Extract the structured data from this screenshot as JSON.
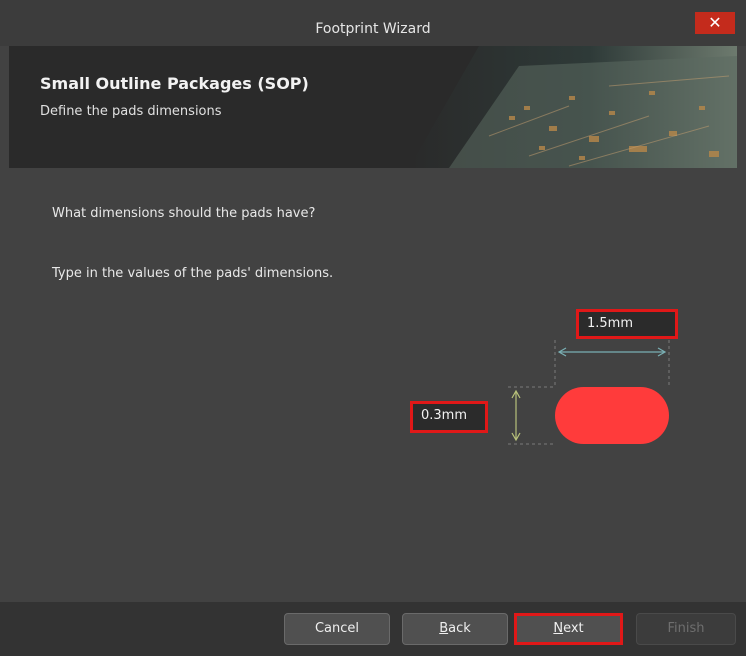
{
  "window": {
    "title": "Footprint Wizard",
    "close_glyph": "✕"
  },
  "header": {
    "title": "Small Outline Packages (SOP)",
    "subtitle": "Define the pads dimensions",
    "banner_image": "pcb-board-image"
  },
  "content": {
    "question": "What dimensions should the pads have?",
    "instruction": "Type in the values of the pads' dimensions."
  },
  "pad": {
    "width_value": "1.5mm",
    "height_value": "0.3mm",
    "pad_color": "#ff3b3b"
  },
  "buttons": {
    "cancel": "Cancel",
    "back_first": "B",
    "back_rest": "ack",
    "next_first": "N",
    "next_rest": "ext",
    "finish": "Finish"
  },
  "colors": {
    "highlight": "#e01818",
    "close": "#c42b1c",
    "width_arrow": "#7ab0b4",
    "height_arrow": "#b8c27a"
  }
}
